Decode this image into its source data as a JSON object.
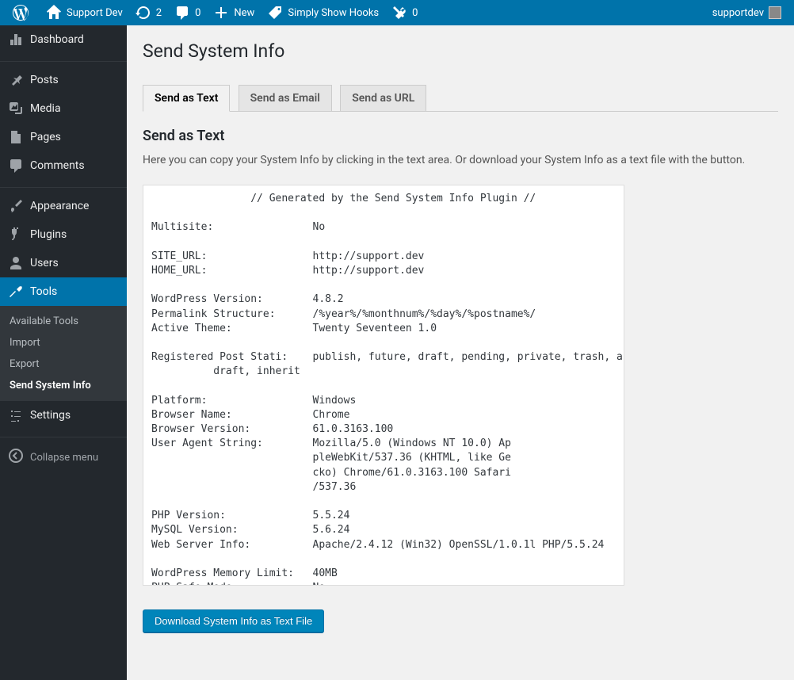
{
  "adminbar": {
    "site_name": "Support Dev",
    "updates_count": "2",
    "comments_count": "0",
    "new_label": "New",
    "hooks_label": "Simply Show Hooks",
    "disabled_count": "0",
    "user_name": "supportdev"
  },
  "sidebar": {
    "dashboard": "Dashboard",
    "posts": "Posts",
    "media": "Media",
    "pages": "Pages",
    "comments": "Comments",
    "appearance": "Appearance",
    "plugins": "Plugins",
    "users": "Users",
    "tools": "Tools",
    "tools_sub": {
      "available": "Available Tools",
      "import": "Import",
      "export": "Export",
      "send_system_info": "Send System Info"
    },
    "settings": "Settings",
    "collapse": "Collapse menu"
  },
  "page": {
    "title": "Send System Info",
    "tabs": {
      "text": "Send as Text",
      "email": "Send as Email",
      "url": "Send as URL"
    },
    "section_title": "Send as Text",
    "description": "Here you can copy your System Info by clicking in the text area. Or download your System Info as a text file with the button.",
    "download_button": "Download System Info as Text File",
    "sysinfo_text": "                // Generated by the Send System Info Plugin //\n\nMultisite:                No\n\nSITE_URL:                 http://support.dev\nHOME_URL:                 http://support.dev\n\nWordPress Version:        4.8.2\nPermalink Structure:      /%year%/%monthnum%/%day%/%postname%/\nActive Theme:             Twenty Seventeen 1.0\n\nRegistered Post Stati:    publish, future, draft, pending, private, trash, auto-\n          draft, inherit\n\nPlatform:                 Windows\nBrowser Name:             Chrome\nBrowser Version:          61.0.3163.100\nUser Agent String:        Mozilla/5.0 (Windows NT 10.0) Ap\n                          pleWebKit/537.36 (KHTML, like Ge\n                          cko) Chrome/61.0.3163.100 Safari\n                          /537.36\n\nPHP Version:              5.5.24\nMySQL Version:            5.6.24\nWeb Server Info:          Apache/2.4.12 (Win32) OpenSSL/1.0.1l PHP/5.5.24\n\nWordPress Memory Limit:   40MB\nPHP Safe Mode:            No"
  }
}
